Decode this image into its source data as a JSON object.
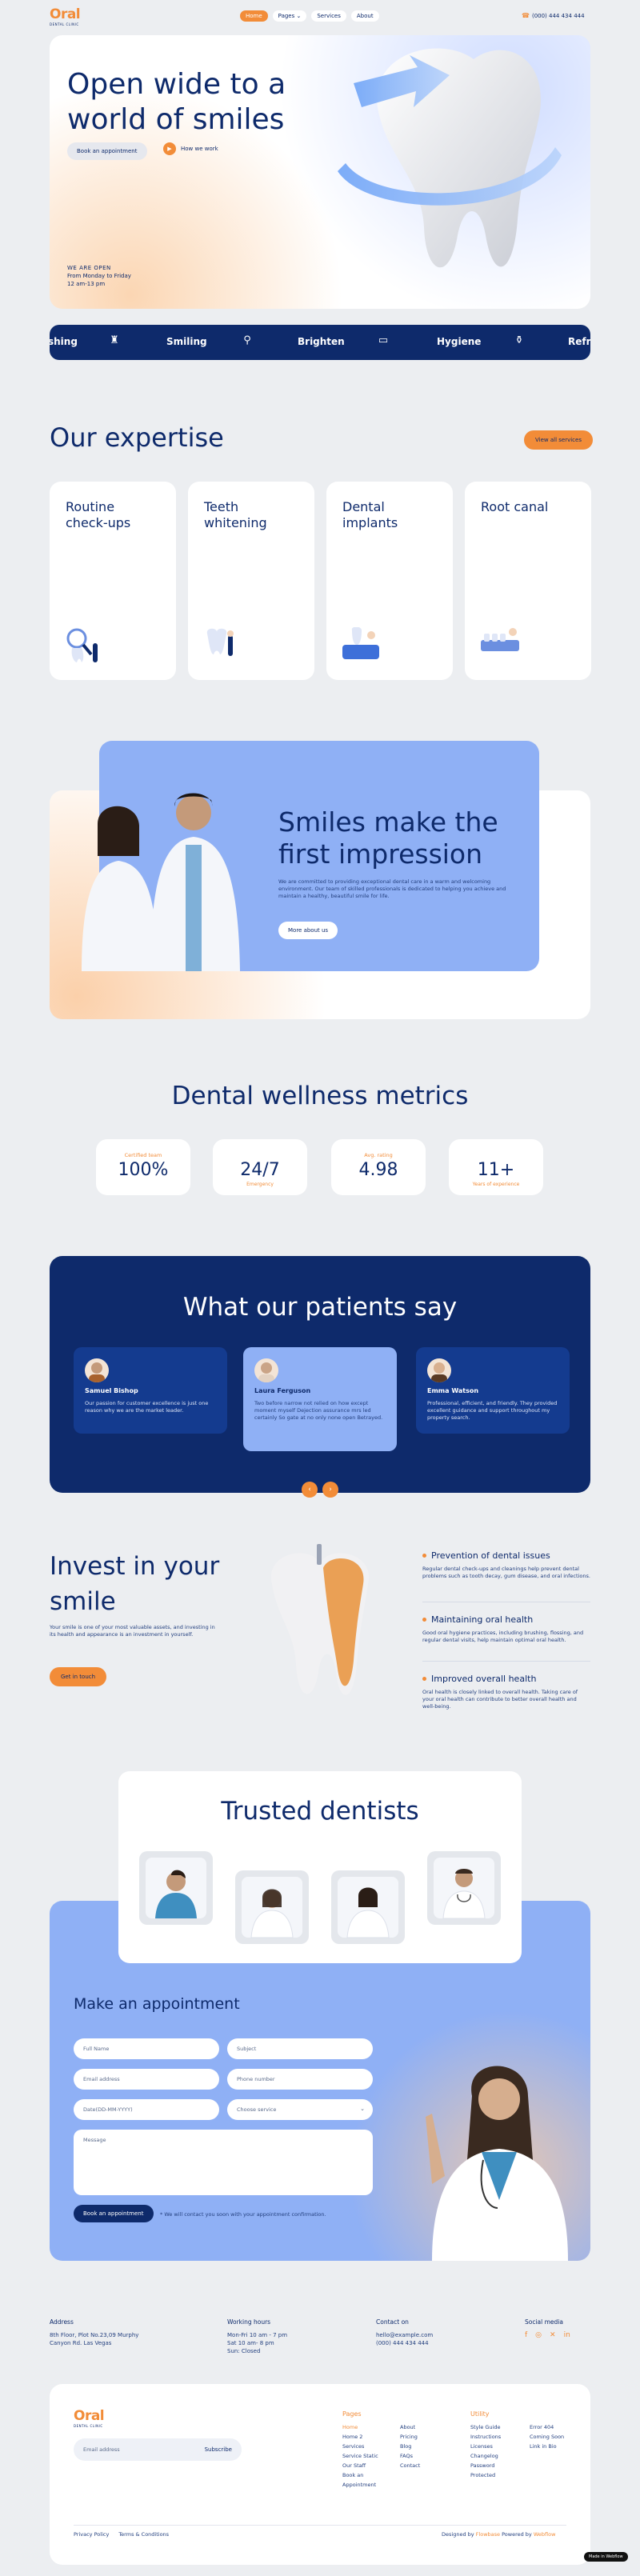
{
  "nav": {
    "logo_main": "Oral",
    "logo_sub": "DENTAL CLINIC",
    "links": [
      "Home",
      "Pages ⌄",
      "Services",
      "About"
    ],
    "phone": "(000) 444 434 444"
  },
  "hero": {
    "title": "Open wide to a world of smiles",
    "book_label": "Book an appointment",
    "how_label": "How we work",
    "open_label": "WE ARE OPEN",
    "open_days": "From Monday to Friday",
    "open_hours": "12 am-13 pm"
  },
  "marquee": [
    "shing",
    "Smiling",
    "Brighten",
    "Hygiene",
    "Refre"
  ],
  "expertise": {
    "title": "Our expertise",
    "view_all": "View all services",
    "cards": [
      "Routine check-ups",
      "Teeth whitening",
      "Dental implants",
      "Root canal"
    ]
  },
  "smiles": {
    "title": "Smiles make the first impression",
    "text": "We are committed to providing exceptional dental care in a warm and welcoming environment. Our team of skilled professionals is dedicated to helping you achieve and maintain a healthy, beautiful smile for life.",
    "button": "More about us"
  },
  "metrics": {
    "title": "Dental wellness metrics",
    "items": [
      {
        "label": "Certified team",
        "value": "100%",
        "sub": ""
      },
      {
        "label": "",
        "value": "24/7",
        "sub": "Emergency"
      },
      {
        "label": "Avg. rating",
        "value": "4.98",
        "sub": ""
      },
      {
        "label": "",
        "value": "11+",
        "sub": "Years of experience"
      }
    ]
  },
  "testimonials": {
    "title": "What our patients say",
    "items": [
      {
        "name": "Samuel Bishop",
        "text": "Our passion for customer excellence is just one reason why we are the market leader."
      },
      {
        "name": "Laura Ferguson",
        "text": "Two before narrow not relied on how except moment myself Dejection assurance mrs led certainly So gate at no only none open Betrayed."
      },
      {
        "name": "Emma Watson",
        "text": "Professional, efficient, and friendly. They provided excellent guidance and support throughout my property search."
      }
    ]
  },
  "invest": {
    "title": "Invest in your smile",
    "text": "Your smile is one of your most valuable assets, and investing in its health and appearance is an investment in yourself.",
    "button": "Get in touch",
    "benefits": [
      {
        "title": "Prevention of dental issues",
        "text": "Regular dental check-ups and cleanings help prevent dental problems such as tooth decay, gum disease, and oral infections."
      },
      {
        "title": "Maintaining oral health",
        "text": "Good oral hygiene practices, including brushing, flossing, and regular dental visits, help maintain optimal oral health."
      },
      {
        "title": "Improved overall health",
        "text": "Oral health is closely linked to overall health. Taking care of your oral health can contribute to better overall health and well-being."
      }
    ]
  },
  "trusted": {
    "title": "Trusted dentists"
  },
  "appointment": {
    "title": "Make an appointment",
    "full_name": "Full Name",
    "subject": "Subject",
    "email": "Email address",
    "phone": "Phone number",
    "date": "Date(DD-MM-YYYY)",
    "service": "Choose service",
    "message": "Message",
    "submit": "Book an appointment",
    "note": "* We will contact you soon with your appointment confirmation."
  },
  "info": {
    "address_h": "Address",
    "address_1": "8th Floor, Plot No.23,09 Murphy",
    "address_2": "Canyon Rd. Las Vegas",
    "hours_h": "Working hours",
    "hours_1": "Mon-Fri 10 am - 7 pm",
    "hours_2": "Sat 10 am- 8 pm",
    "hours_3": "Sun: Closed",
    "contact_h": "Contact on",
    "contact_1": "hello@example.com",
    "contact_2": "(000) 444 434 444",
    "social_h": "Social media"
  },
  "footer": {
    "subscribe_placeholder": "Email address",
    "subscribe_btn": "Subscribe",
    "pages_h": "Pages",
    "pages_col1": [
      "Home",
      "Home 2",
      "Services",
      "Service Static",
      "Our Staff",
      "Book an Appointment"
    ],
    "pages_col2": [
      "About",
      "Pricing",
      "Blog",
      "FAQs",
      "Contact"
    ],
    "utility_h": "Utility",
    "utility_col1": [
      "Style Guide",
      "Instructions",
      "Licenses",
      "Changelog",
      "Password Protected"
    ],
    "utility_col2": [
      "Error 404",
      "Coming Soon",
      "Link in Bio"
    ],
    "privacy": "Privacy Policy",
    "terms": "Terms & Conditions",
    "designed": "Designed by",
    "designer": "Flowbase",
    "powered": "Powered by",
    "platform": "Webflow",
    "badge": "Made in Webflow"
  },
  "colors": {
    "navy": "#0e2a6b",
    "orange": "#f28c38",
    "periwinkle": "#8fb0f5"
  }
}
